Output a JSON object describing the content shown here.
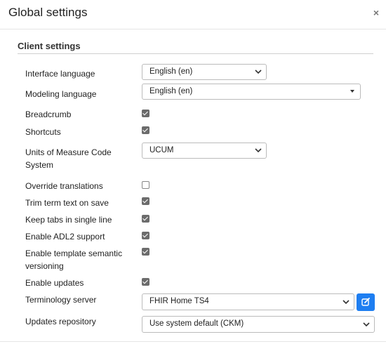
{
  "dialog": {
    "title": "Global settings",
    "close_glyph": "×"
  },
  "section": {
    "title": "Client settings"
  },
  "rows": {
    "interface_language": {
      "label": "Interface language",
      "value": "English (en)"
    },
    "modeling_language": {
      "label": "Modeling language",
      "value": "English (en)"
    },
    "breadcrumb": {
      "label": "Breadcrumb",
      "checked": true
    },
    "shortcuts": {
      "label": "Shortcuts",
      "checked": true
    },
    "units": {
      "label": "Units of Measure Code System",
      "value": "UCUM"
    },
    "override_translations": {
      "label": "Override translations",
      "checked": false
    },
    "trim_term": {
      "label": "Trim term text on save",
      "checked": true
    },
    "keep_tabs": {
      "label": "Keep tabs in single line",
      "checked": true
    },
    "enable_adl2": {
      "label": "Enable ADL2 support",
      "checked": true
    },
    "template_versioning": {
      "label": "Enable template semantic versioning",
      "checked": true
    },
    "enable_updates": {
      "label": "Enable updates",
      "checked": true
    },
    "terminology_server": {
      "label": "Terminology server",
      "value": "FHIR Home TS4"
    },
    "updates_repository": {
      "label": "Updates repository",
      "value": "Use system default (CKM)"
    }
  },
  "colors": {
    "primary_button": "#1e7ef1",
    "checkbox_checked": "#6c6c6c"
  },
  "icons": {
    "edit_button": "edit-icon",
    "close": "close-icon"
  }
}
